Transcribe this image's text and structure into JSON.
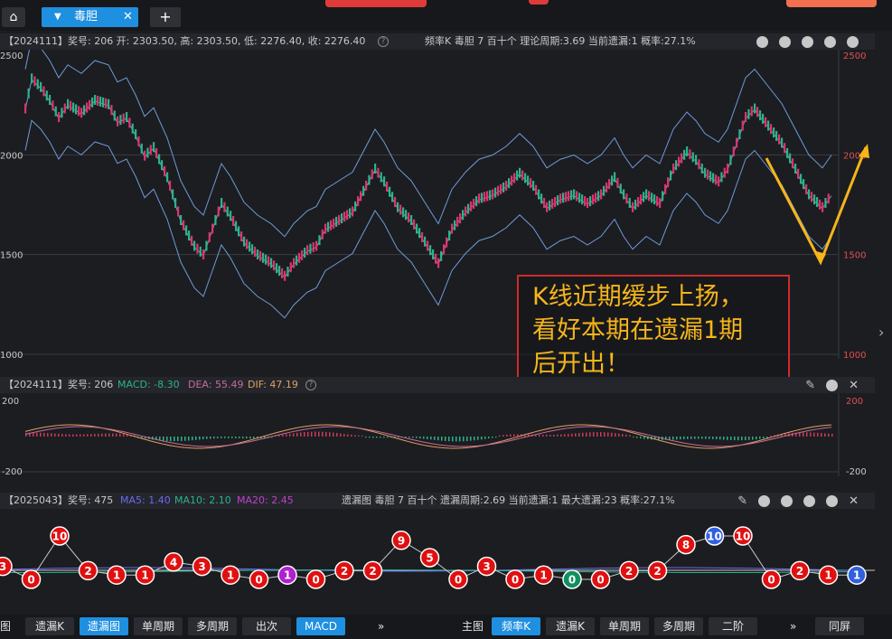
{
  "tabs": {
    "home_icon": "home-icon",
    "active_tab": "毒胆",
    "close": "✕",
    "add": "+"
  },
  "main": {
    "info": "【2024111】奖号: 206  开: 2303.50, 高: 2303.50, 低: 2276.40, 收: 2276.40",
    "info2": "频率K  毒胆  7  百十个  理论周期:3.69  当前遗漏:1  概率:27.1%",
    "y_labels_left": [
      "2500",
      "2000",
      "1500",
      "1000"
    ],
    "y_labels_right": [
      "2500",
      "2000",
      "1500",
      "1000"
    ],
    "y_values": [
      2500,
      2000,
      1500,
      1000
    ],
    "callout": [
      "K线近期缓步上扬，",
      "看好本期在遗漏1期",
      "后开出！"
    ]
  },
  "macd": {
    "label": "【2024111】奖号: 206",
    "macd_text": "MACD: -8.30",
    "dea_text": "DEA: 55.49",
    "dif_text": "DIF: 47.19",
    "y_labels": [
      "200",
      "-200"
    ],
    "colors": {
      "macd": "#2bb38a",
      "dea": "#c86b9c",
      "dif": "#e0a060"
    }
  },
  "miss": {
    "label": "【2025043】奖号: 475",
    "ma5": "MA5: 1.40",
    "ma10": "MA10: 2.10",
    "ma20": "MA20: 2.45",
    "info2": "遗漏图  毒胆  7  百十个  遗漏周期:2.69  当前遗漏:1  最大遗漏:23  概率:27.1%",
    "colors": {
      "ma5": "#6a6af0",
      "ma10": "#2bb38a",
      "ma20": "#c040d0"
    },
    "balls": [
      {
        "v": "3",
        "c": "red"
      },
      {
        "v": "0",
        "c": "red"
      },
      {
        "v": "10",
        "c": "red"
      },
      {
        "v": "2",
        "c": "red"
      },
      {
        "v": "1",
        "c": "red"
      },
      {
        "v": "1",
        "c": "red"
      },
      {
        "v": "4",
        "c": "red"
      },
      {
        "v": "3",
        "c": "red"
      },
      {
        "v": "1",
        "c": "red"
      },
      {
        "v": "0",
        "c": "red"
      },
      {
        "v": "1",
        "c": "purple"
      },
      {
        "v": "0",
        "c": "red"
      },
      {
        "v": "2",
        "c": "red"
      },
      {
        "v": "2",
        "c": "red"
      },
      {
        "v": "9",
        "c": "red"
      },
      {
        "v": "5",
        "c": "red"
      },
      {
        "v": "0",
        "c": "red"
      },
      {
        "v": "3",
        "c": "red"
      },
      {
        "v": "0",
        "c": "red"
      },
      {
        "v": "1",
        "c": "red"
      },
      {
        "v": "0",
        "c": "green"
      },
      {
        "v": "0",
        "c": "red"
      },
      {
        "v": "2",
        "c": "red"
      },
      {
        "v": "2",
        "c": "red"
      },
      {
        "v": "8",
        "c": "red"
      },
      {
        "v": "10",
        "c": "blue"
      },
      {
        "v": "10",
        "c": "red"
      },
      {
        "v": "0",
        "c": "red"
      },
      {
        "v": "2",
        "c": "red"
      },
      {
        "v": "1",
        "c": "red"
      },
      {
        "v": "1",
        "c": "blue"
      }
    ]
  },
  "bottom": {
    "left_partial": "图",
    "b1": "遗漏K",
    "b2": "遗漏图",
    "b3": "单周期",
    "b4": "多周期",
    "b5": "出次",
    "b6": "MACD",
    "b7": "»",
    "main_label": "主图",
    "r1": "频率K",
    "r2": "遗漏K",
    "r3": "单周期",
    "r4": "多周期",
    "r5": "二阶",
    "r6": "»",
    "r7": "同屏"
  }
}
